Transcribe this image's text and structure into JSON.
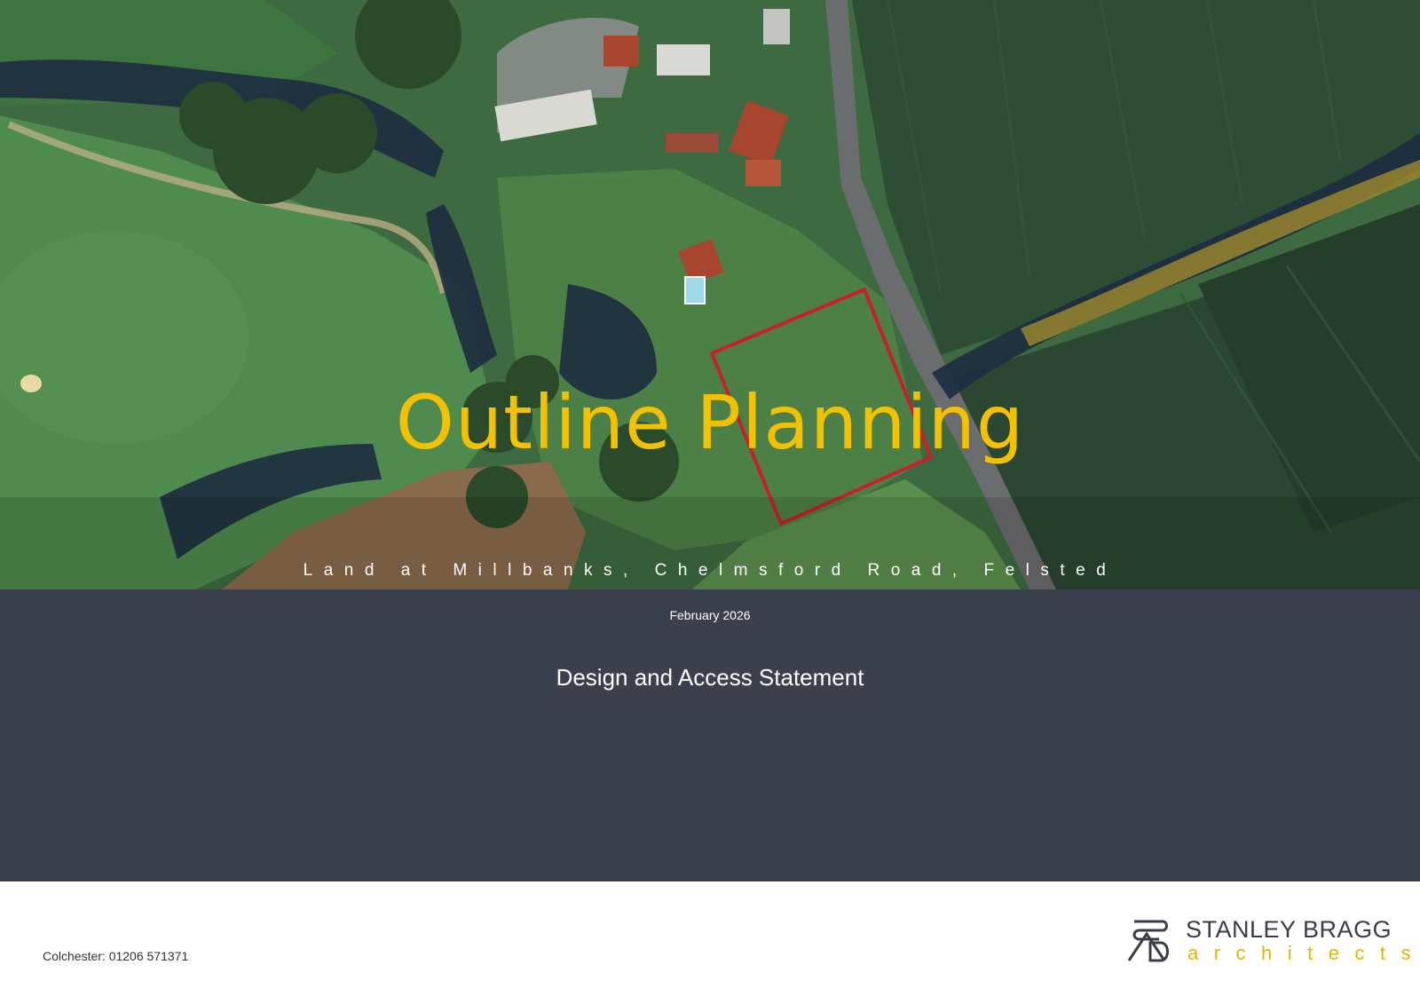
{
  "hero": {
    "title": "Outline Planning",
    "subtitle": "Land at Millbanks, Chelmsford Road, Felsted"
  },
  "panel": {
    "date": "February 2026",
    "document_type": "Design and Access Statement"
  },
  "footer": {
    "contact": "Colchester: 01206 571371",
    "logo_name": "STANLEY BRAGG",
    "logo_sub": "architects"
  },
  "colors": {
    "title_accent": "#f2c200",
    "panel_background": "#3c404c",
    "site_boundary": "#c8202a",
    "logo_accent": "#e6b400"
  }
}
